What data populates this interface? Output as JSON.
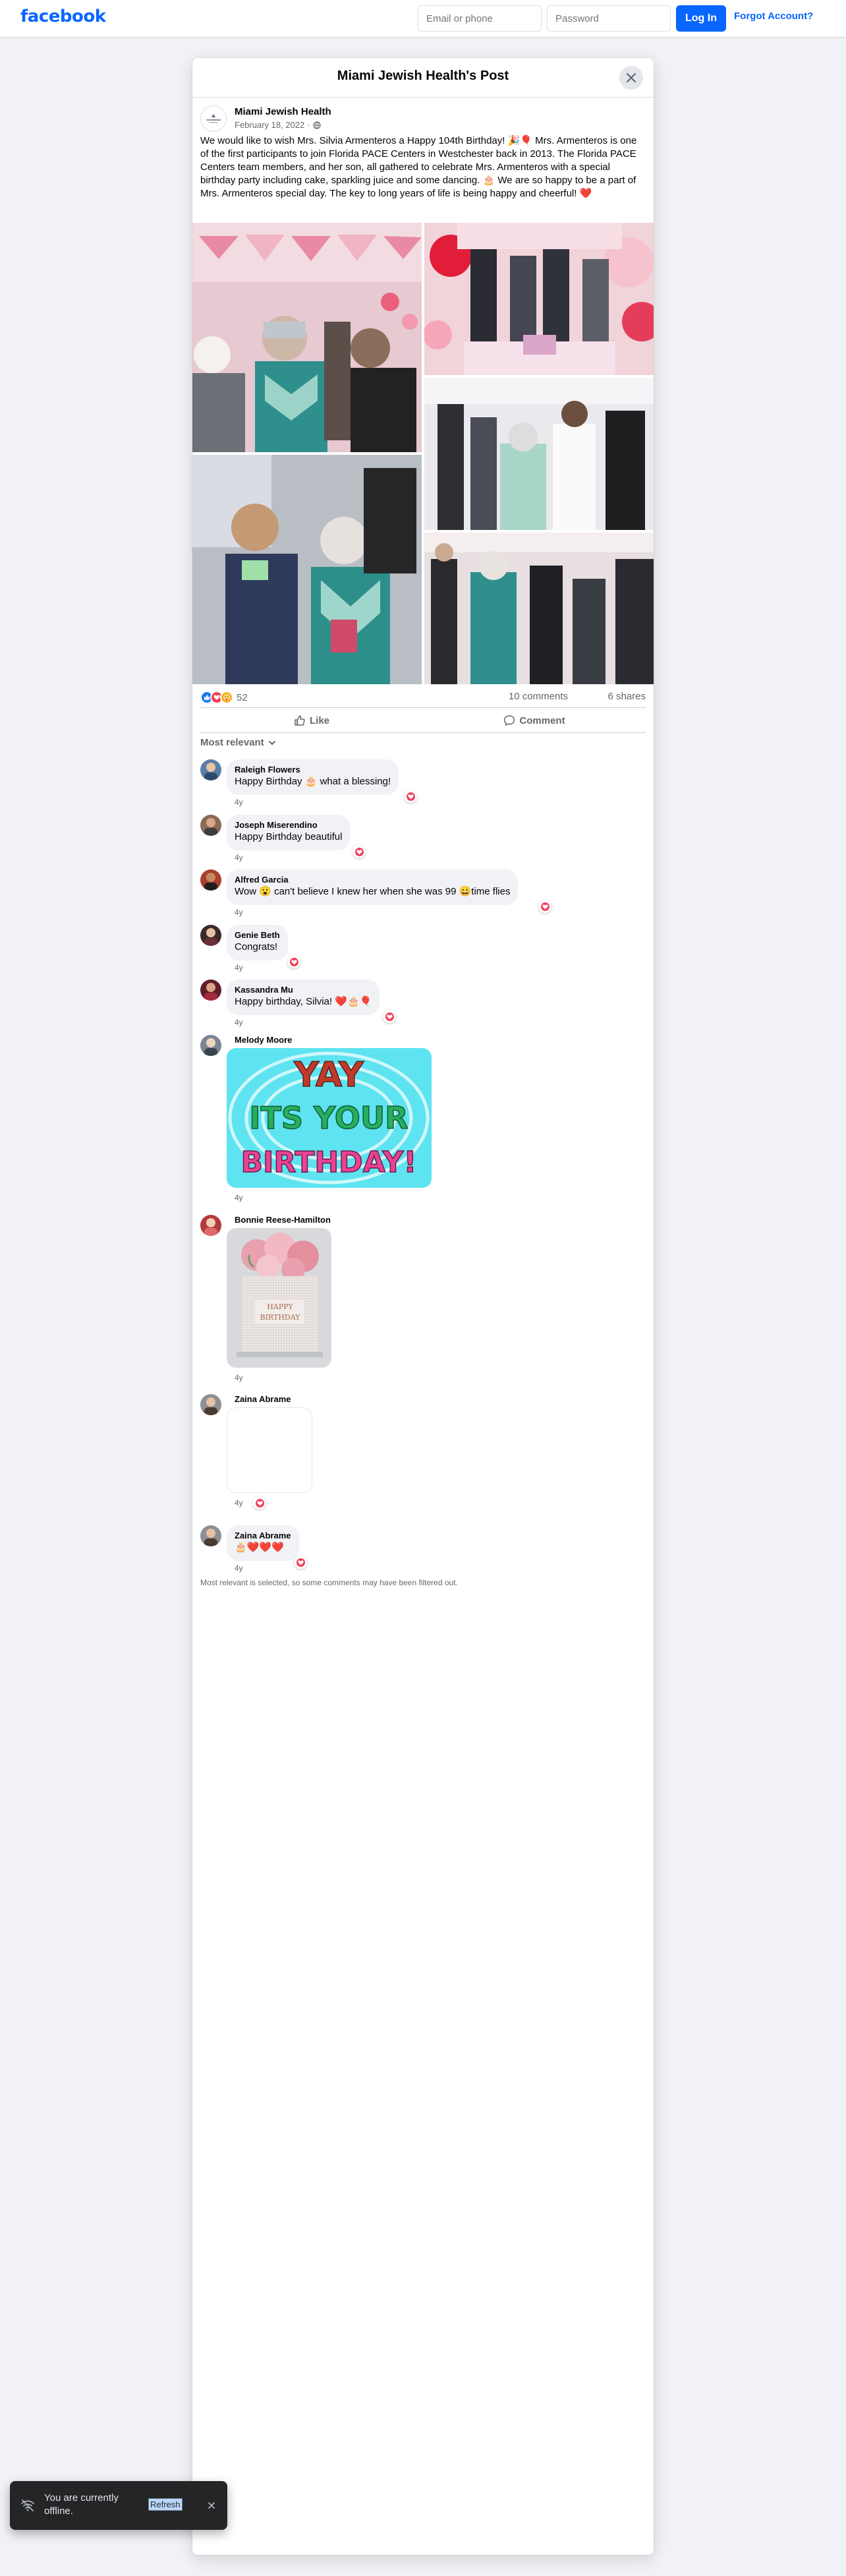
{
  "topbar": {
    "logo": "facebook",
    "email_placeholder": "Email or phone",
    "password_placeholder": "Password",
    "login_label": "Log In",
    "forgot_label": "Forgot Account?"
  },
  "dialog": {
    "title": "Miami Jewish Health's Post"
  },
  "post": {
    "author": "Miami Jewish Health",
    "date": "February 18, 2022",
    "privacy_icon": "globe-icon",
    "text": "We would like to wish Mrs. Silvia Armenteros a Happy 104th Birthday! 🎉🎈 Mrs. Armenteros is one of the first participants to join Florida PACE Centers in Westchester back in 2013. The Florida PACE Centers team members, and her son, all gathered to celebrate Mrs. Armenteros with a special birthday party including cake, sparkling juice and some dancing. 🎂 We are so happy to be a part of Mrs. Armenteros special day. The key to long years of life is being happy and cheerful! ❤️",
    "reaction_count": "52",
    "comment_count": "10 comments",
    "share_count": "6 shares",
    "like_label": "Like",
    "comment_label": "Comment"
  },
  "colors": {
    "brand": "#0866ff",
    "like": "#1877f2",
    "love": "#f33e58",
    "care": "#f7b125"
  },
  "comments": {
    "sort_label": "Most relevant",
    "items": [
      {
        "name": "Raleigh Flowers",
        "text": "Happy Birthday 🎂 what a blessing!",
        "time": "4y"
      },
      {
        "name": "Joseph Miserendino",
        "text": "Happy Birthday beautiful",
        "time": "4y"
      },
      {
        "name": "Alfred Garcia",
        "text": "Wow 😮 can't believe I knew her when she was 99 😀time flies",
        "time": "4y"
      },
      {
        "name": "Genie Beth",
        "text": "Congrats!",
        "time": "4y"
      },
      {
        "name": "Kassandra Mu",
        "text": "Happy birthday, Silvia! ❤️🎂🎈",
        "time": "4y"
      },
      {
        "name": "Melody Moore",
        "time": "4y",
        "gif_text": [
          "YAY",
          "ITS YOUR",
          "BIRTHDAY!"
        ]
      },
      {
        "name": "Bonnie Reese-Hamilton",
        "time": "4y",
        "cake_text": [
          "HAPPY",
          "BIRTHDAY"
        ]
      },
      {
        "name": "Zaina Abrame",
        "time": "4y"
      },
      {
        "name": "Zaina Abrame",
        "text": "🎂❤️❤️❤️",
        "time": "4y"
      }
    ],
    "filter_note": "Most relevant is selected, so some comments may have been filtered out."
  },
  "toast": {
    "text": "You are currently offline.",
    "refresh_label": "Refresh",
    "icon": "wifi-off-icon"
  }
}
